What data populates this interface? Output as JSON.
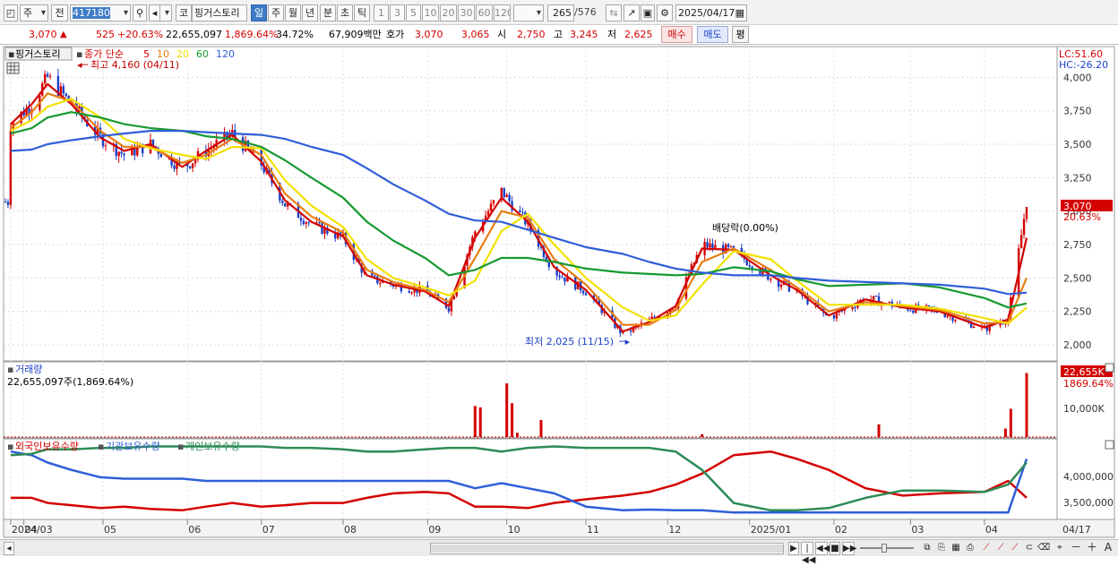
{
  "toolbar": {
    "market": "주",
    "period_type": "전",
    "code": "417180",
    "ko_label": "코",
    "stock_name": "핑거스토리",
    "periods": [
      "일",
      "주",
      "월",
      "년",
      "분",
      "초",
      "틱"
    ],
    "numbers": [
      "1",
      "3",
      "5",
      "10",
      "20",
      "30",
      "60",
      "120"
    ],
    "count": "265",
    "count_total": "/576",
    "date": "2025/04/17"
  },
  "infobar": {
    "price": "3,070",
    "change_arrow": "▲",
    "change": "525",
    "change_pct": "+20.63%",
    "volume": "22,655,097",
    "volume_pct": "1,869.64%",
    "turnover": "34.72%",
    "amount": "67,909백만",
    "quote_label": "호가",
    "ask": "3,070",
    "bid": "3,065",
    "open_label": "시",
    "open": "2,750",
    "high_label": "고",
    "high": "3,245",
    "low_label": "저",
    "low": "2,625",
    "buy_label": "매수",
    "sell_label": "매도",
    "eval_label": "평",
    "colors": {
      "up": "#d40000",
      "down": "#1b3fc7"
    }
  },
  "chart_data": [
    {
      "type": "candlestick",
      "title_tab": "핑거스토리",
      "legend": {
        "label": "종가 단순",
        "periods": [
          {
            "label": "5",
            "color": "#d40000"
          },
          {
            "label": "10",
            "color": "#e87d12"
          },
          {
            "label": "20",
            "color": "#f2e100"
          },
          {
            "label": "60",
            "color": "#179a30"
          },
          {
            "label": "120",
            "color": "#2f5ed8"
          }
        ]
      },
      "y_ticks": [
        2000,
        2250,
        2500,
        2750,
        3000,
        3250,
        3500,
        3750,
        4000
      ],
      "y_tick_labels": [
        "2,000",
        "2,250",
        "2,500",
        "2,750",
        "3,000",
        "3,250",
        "3,500",
        "3,750",
        "4,000"
      ],
      "ylim": [
        1880,
        4230
      ],
      "lc_label": "LC:51.60",
      "hc_label": "HC:-26.20",
      "last_price_label": "3,070",
      "last_change_label": "20.63%",
      "high_annotation": "최고 4,160 (04/11)",
      "low_annotation": "최저 2,025 (11/15)",
      "dividend_annotation": "배당락(0.00%)",
      "series_close": [
        {
          "date": "2024-03-28",
          "value": 3650
        },
        {
          "date": "2024-04-05",
          "value": 3800
        },
        {
          "date": "2024-04-11",
          "value": 4000
        },
        {
          "date": "2024-04-20",
          "value": 3800
        },
        {
          "date": "2024-05-01",
          "value": 3550
        },
        {
          "date": "2024-05-10",
          "value": 3420
        },
        {
          "date": "2024-05-20",
          "value": 3500
        },
        {
          "date": "2024-06-01",
          "value": 3320
        },
        {
          "date": "2024-06-10",
          "value": 3450
        },
        {
          "date": "2024-06-20",
          "value": 3580
        },
        {
          "date": "2024-07-01",
          "value": 3350
        },
        {
          "date": "2024-07-10",
          "value": 3050
        },
        {
          "date": "2024-07-20",
          "value": 2900
        },
        {
          "date": "2024-08-01",
          "value": 2800
        },
        {
          "date": "2024-08-10",
          "value": 2500
        },
        {
          "date": "2024-08-20",
          "value": 2450
        },
        {
          "date": "2024-09-01",
          "value": 2400
        },
        {
          "date": "2024-09-10",
          "value": 2280
        },
        {
          "date": "2024-09-20",
          "value": 2850
        },
        {
          "date": "2024-09-30",
          "value": 3150
        },
        {
          "date": "2024-10-10",
          "value": 2900
        },
        {
          "date": "2024-10-20",
          "value": 2550
        },
        {
          "date": "2024-11-01",
          "value": 2400
        },
        {
          "date": "2024-11-15",
          "value": 2080
        },
        {
          "date": "2024-11-25",
          "value": 2180
        },
        {
          "date": "2024-12-05",
          "value": 2300
        },
        {
          "date": "2024-12-15",
          "value": 2750
        },
        {
          "date": "2024-12-27",
          "value": 2700
        },
        {
          "date": "2025-01-10",
          "value": 2500
        },
        {
          "date": "2025-01-20",
          "value": 2400
        },
        {
          "date": "2025-02-01",
          "value": 2200
        },
        {
          "date": "2025-02-15",
          "value": 2350
        },
        {
          "date": "2025-03-01",
          "value": 2280
        },
        {
          "date": "2025-03-15",
          "value": 2250
        },
        {
          "date": "2025-04-01",
          "value": 2120
        },
        {
          "date": "2025-04-10",
          "value": 2200
        },
        {
          "date": "2025-04-17",
          "value": 3070
        }
      ],
      "ma": [
        {
          "name": "5",
          "color": "#d40000",
          "values": [
            3650,
            3800,
            3950,
            3800,
            3550,
            3450,
            3500,
            3330,
            3450,
            3570,
            3370,
            3080,
            2920,
            2810,
            2520,
            2450,
            2400,
            2290,
            2800,
            3100,
            2920,
            2580,
            2410,
            2100,
            2170,
            2290,
            2720,
            2710,
            2520,
            2410,
            2220,
            2340,
            2280,
            2250,
            2130,
            2190,
            2800
          ]
        },
        {
          "name": "10",
          "color": "#e87d12",
          "values": [
            3620,
            3740,
            3880,
            3820,
            3600,
            3480,
            3480,
            3360,
            3420,
            3540,
            3420,
            3130,
            2960,
            2840,
            2560,
            2470,
            2410,
            2320,
            2650,
            3000,
            2950,
            2640,
            2450,
            2150,
            2150,
            2260,
            2620,
            2720,
            2560,
            2430,
            2250,
            2320,
            2290,
            2260,
            2160,
            2170,
            2500
          ]
        },
        {
          "name": "20",
          "color": "#f2e100",
          "values": [
            3600,
            3680,
            3780,
            3840,
            3700,
            3540,
            3470,
            3420,
            3390,
            3480,
            3470,
            3230,
            3040,
            2880,
            2640,
            2500,
            2430,
            2370,
            2480,
            2850,
            2980,
            2750,
            2500,
            2280,
            2180,
            2220,
            2450,
            2700,
            2640,
            2480,
            2300,
            2300,
            2300,
            2270,
            2200,
            2160,
            2280
          ]
        },
        {
          "name": "60",
          "color": "#179a30",
          "values": [
            3580,
            3620,
            3700,
            3740,
            3700,
            3650,
            3620,
            3600,
            3560,
            3540,
            3480,
            3380,
            3250,
            3100,
            2920,
            2780,
            2650,
            2520,
            2560,
            2650,
            2650,
            2620,
            2570,
            2540,
            2530,
            2520,
            2530,
            2580,
            2550,
            2490,
            2440,
            2450,
            2460,
            2430,
            2350,
            2280,
            2310
          ]
        },
        {
          "name": "120",
          "color": "#2f5ed8",
          "values": [
            3450,
            3460,
            3500,
            3530,
            3560,
            3580,
            3600,
            3600,
            3590,
            3580,
            3570,
            3540,
            3480,
            3420,
            3320,
            3200,
            3080,
            2980,
            2930,
            2920,
            2860,
            2800,
            2730,
            2680,
            2620,
            2570,
            2540,
            2520,
            2520,
            2500,
            2480,
            2470,
            2460,
            2450,
            2420,
            2380,
            2390
          ]
        }
      ]
    },
    {
      "type": "bar",
      "title": "거래량",
      "value_label": "22,655,097주(1,869.64%)",
      "y_tick_labels": [
        "10,000K"
      ],
      "ylim": [
        0,
        26000
      ],
      "last_label": "22,655K",
      "last_pct_label": "1869.64%",
      "spikes": [
        {
          "date": "2024-09-20",
          "value": 11000
        },
        {
          "date": "2024-09-22",
          "value": 10500
        },
        {
          "date": "2024-10-02",
          "value": 19000
        },
        {
          "date": "2024-10-04",
          "value": 12000
        },
        {
          "date": "2024-10-06",
          "value": 1500
        },
        {
          "date": "2024-10-15",
          "value": 6000
        },
        {
          "date": "2024-12-15",
          "value": 1000
        },
        {
          "date": "2025-02-20",
          "value": 4500
        },
        {
          "date": "2025-04-09",
          "value": 3000
        },
        {
          "date": "2025-04-11",
          "value": 10000
        },
        {
          "date": "2025-04-17",
          "value": 22655
        }
      ]
    },
    {
      "type": "line",
      "legend": [
        {
          "label": "외국인보유수량",
          "color": "#d40000"
        },
        {
          "label": "기관보유수량",
          "color": "#2f5ed8"
        },
        {
          "label": "개인보유수량",
          "color": "#2e8b57"
        }
      ],
      "y_tick_labels": [
        "4,000,000",
        "3,500,000"
      ],
      "series": [
        {
          "name": "외국인보유수량",
          "values": [
            3.62,
            3.62,
            3.55,
            3.52,
            3.48,
            3.5,
            3.47,
            3.45,
            3.5,
            3.55,
            3.5,
            3.52,
            3.55,
            3.55,
            3.62,
            3.68,
            3.7,
            3.68,
            3.5,
            3.5,
            3.48,
            3.55,
            3.6,
            3.65,
            3.7,
            3.8,
            3.95,
            4.2,
            4.25,
            4.15,
            4.0,
            3.75,
            3.65,
            3.68,
            3.7,
            3.85,
            3.62
          ]
        },
        {
          "name": "기관보유수량",
          "values": [
            4.25,
            4.2,
            4.1,
            4.0,
            3.9,
            3.88,
            3.88,
            3.88,
            3.85,
            3.85,
            3.85,
            3.85,
            3.85,
            3.85,
            3.85,
            3.85,
            3.85,
            3.85,
            3.75,
            3.82,
            3.75,
            3.68,
            3.5,
            3.45,
            3.46,
            3.45,
            3.45,
            3.42,
            3.42,
            3.42,
            3.42,
            3.42,
            3.42,
            3.42,
            3.42,
            3.42,
            4.15
          ]
        },
        {
          "name": "개인보유수량",
          "values": [
            4.2,
            4.22,
            4.28,
            4.28,
            4.3,
            4.3,
            4.32,
            4.32,
            4.32,
            4.32,
            4.32,
            4.3,
            4.3,
            4.28,
            4.25,
            4.25,
            4.28,
            4.3,
            4.3,
            4.25,
            4.3,
            4.32,
            4.3,
            4.3,
            4.3,
            4.25,
            4.0,
            3.55,
            3.45,
            3.45,
            3.48,
            3.62,
            3.72,
            3.72,
            3.7,
            3.8,
            4.1
          ]
        }
      ]
    }
  ],
  "x_axis": {
    "labels": [
      {
        "text": "2024/03",
        "date": "2024-03-28"
      },
      {
        "text": "04",
        "date": "2024-04-02"
      },
      {
        "text": "05",
        "date": "2024-05-02"
      },
      {
        "text": "06",
        "date": "2024-06-03"
      },
      {
        "text": "07",
        "date": "2024-07-01"
      },
      {
        "text": "08",
        "date": "2024-08-01"
      },
      {
        "text": "09",
        "date": "2024-09-02"
      },
      {
        "text": "10",
        "date": "2024-10-02"
      },
      {
        "text": "11",
        "date": "2024-11-01"
      },
      {
        "text": "12",
        "date": "2024-12-02"
      },
      {
        "text": "2025/01",
        "date": "2025-01-02"
      },
      {
        "text": "02",
        "date": "2025-02-03"
      },
      {
        "text": "03",
        "date": "2025-03-04"
      },
      {
        "text": "04",
        "date": "2025-04-01"
      }
    ],
    "right_label": "04/17"
  },
  "bottombar": {
    "nav_buttons": [
      "▶",
      "|◀◀",
      "◀◀",
      "■",
      "▶▶"
    ],
    "zoom_icons": [
      "－",
      "＋",
      "A"
    ]
  }
}
